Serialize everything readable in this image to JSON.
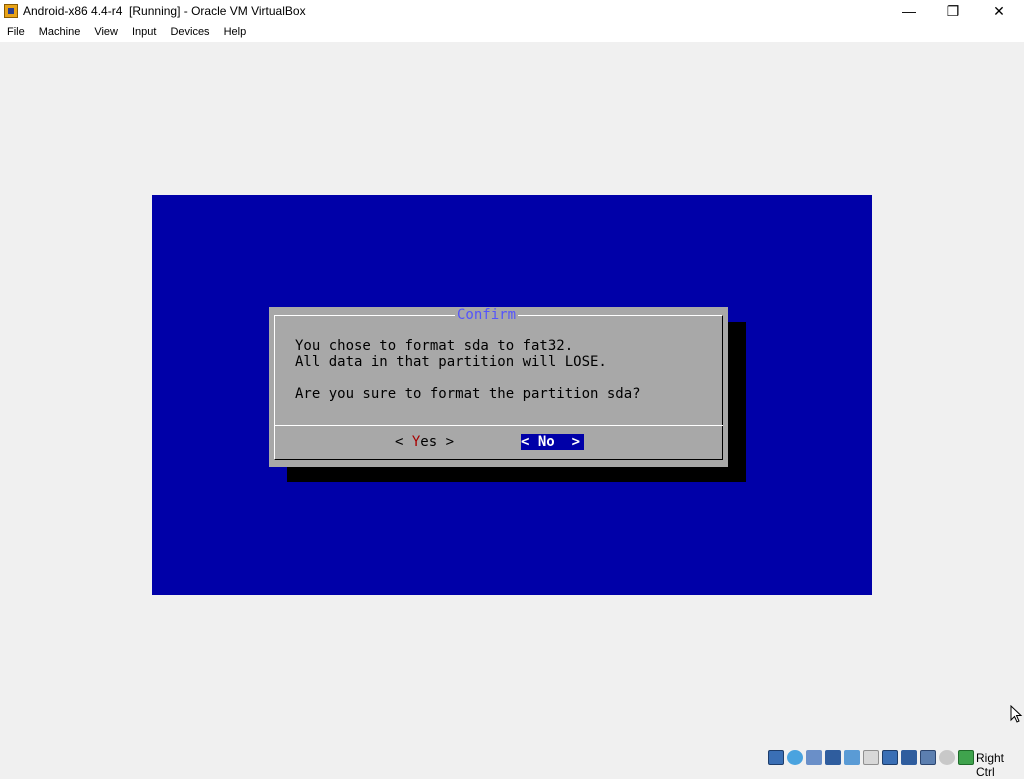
{
  "window": {
    "title": "Android-x86 4.4-r4  [Running] - Oracle VM VirtualBox",
    "minimize_glyph": "—",
    "restore_glyph": "❐",
    "close_glyph": "✕"
  },
  "menu": {
    "items": [
      {
        "label": "File"
      },
      {
        "label": "Machine"
      },
      {
        "label": "View"
      },
      {
        "label": "Input"
      },
      {
        "label": "Devices"
      },
      {
        "label": "Help"
      }
    ]
  },
  "dialog": {
    "title": "Confirm",
    "line1": "You chose to format sda to fat32.",
    "line2": "All data in that partition will LOSE.",
    "question": "Are you sure to format the partition sda?",
    "yes_left": "< ",
    "yes_hotkey": "Y",
    "yes_rest": "es >",
    "no_label": "< No  >"
  },
  "statusbar": {
    "icons": [
      "hard-disk-icon",
      "optical-drive-icon",
      "audio-icon",
      "network-icon",
      "usb-icon",
      "shared-folders-icon",
      "display-icon",
      "recording-icon",
      "cpu-icon",
      "mouse-integration-icon",
      "host-key-icon"
    ],
    "host_key": "Right Ctrl"
  },
  "colors": {
    "vm_background": "#0000a8",
    "dialog_gray": "#a8a8a8",
    "title_blue": "#5454fc",
    "hotkey_red": "#a80000"
  }
}
